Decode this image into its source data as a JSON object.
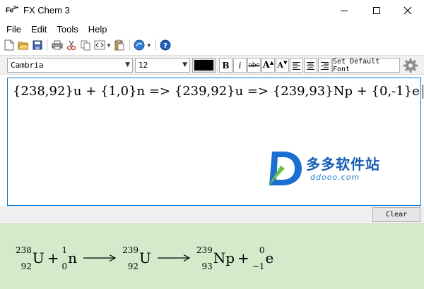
{
  "window": {
    "logo": "Fe",
    "logo_sup": "2+",
    "title": "FX Chem 3"
  },
  "menu": {
    "file": "File",
    "edit": "Edit",
    "tools": "Tools",
    "help": "Help"
  },
  "format": {
    "font": "Cambria",
    "size": "12",
    "color": "#000000",
    "bold": "B",
    "italic": "i",
    "strike": "abc",
    "grow": "A",
    "shrink": "A",
    "set_default_font": "Set Default Font"
  },
  "editor": {
    "text": "{238,92}u + {1,0}n => {239,92}u => {239,93}Np + {0,-1}e"
  },
  "watermark": {
    "text": "多多软件站",
    "sub": "ddooo.com"
  },
  "clear_label": "Clear",
  "preview": {
    "n1_mass": "238",
    "n1_num": "92",
    "n1_sym": "U",
    "plus1": "+",
    "n2_mass": "1",
    "n2_num": "0",
    "n2_sym": "n",
    "n3_mass": "239",
    "n3_num": "92",
    "n3_sym": "U",
    "n4_mass": "239",
    "n4_num": "93",
    "n4_sym": "Np",
    "plus2": "+",
    "n5_mass": "0",
    "n5_num": "−1",
    "n5_sym": "e"
  },
  "colors": {
    "preview_bg": "#d3ebcb",
    "accent": "#0078d7"
  }
}
